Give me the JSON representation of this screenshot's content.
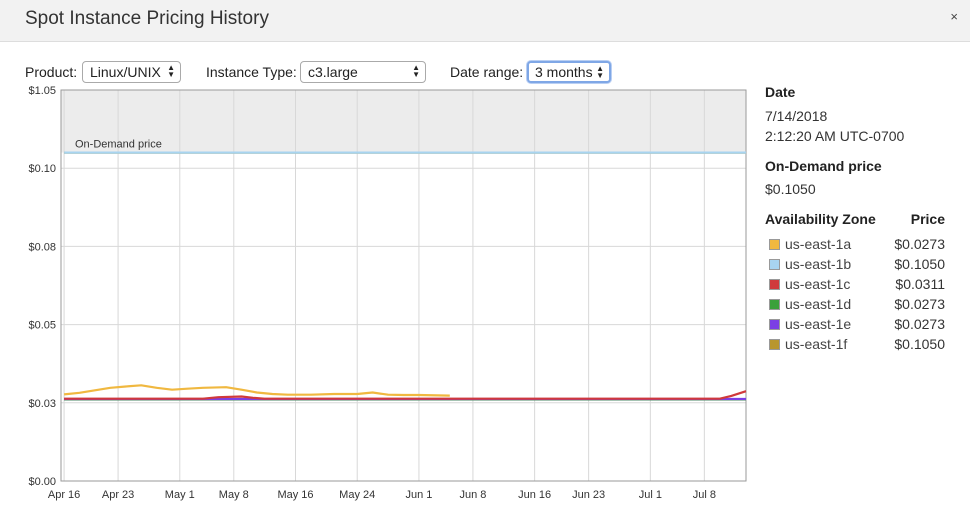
{
  "window": {
    "title": "Spot Instance Pricing History",
    "close_glyph": "×"
  },
  "controls": {
    "product_label": "Product:",
    "product_value": "Linux/UNIX",
    "instance_type_label": "Instance Type:",
    "instance_type_value": "c3.large",
    "date_range_label": "Date range:",
    "date_range_value": "3 months"
  },
  "details": {
    "date_heading": "Date",
    "date_value": "7/14/2018",
    "time_value": "2:12:20 AM UTC-0700",
    "on_demand_heading": "On-Demand price",
    "on_demand_value": "$0.1050",
    "az_heading": "Availability Zone",
    "price_heading": "Price",
    "zones": [
      {
        "name": "us-east-1a",
        "price": "$0.0273",
        "color": "#f0b840"
      },
      {
        "name": "us-east-1b",
        "price": "$0.1050",
        "color": "#a8d4f0"
      },
      {
        "name": "us-east-1c",
        "price": "$0.0311",
        "color": "#d0393b"
      },
      {
        "name": "us-east-1d",
        "price": "$0.0273",
        "color": "#3aa13a"
      },
      {
        "name": "us-east-1e",
        "price": "$0.0273",
        "color": "#7b3fe4"
      },
      {
        "name": "us-east-1f",
        "price": "$0.1050",
        "color": "#b8962e"
      }
    ]
  },
  "chart_data": {
    "type": "line",
    "xlabel": "",
    "ylabel": "",
    "x_ticks": [
      "Apr 16",
      "Apr 23",
      "May 1",
      "May 8",
      "May 16",
      "May 24",
      "Jun 1",
      "Jun 8",
      "Jun 16",
      "Jun 23",
      "Jul 1",
      "Jul 8"
    ],
    "x_tick_days": [
      0,
      7,
      15,
      22,
      30,
      38,
      46,
      53,
      61,
      68,
      76,
      83
    ],
    "x_range_days": [
      -0.4,
      88.4
    ],
    "y_ticks": [
      0.0,
      0.025,
      0.05,
      0.075,
      0.1,
      0.125
    ],
    "y_tick_labels": [
      "$0.00",
      "$0.03",
      "$0.05",
      "$0.08",
      "$0.10",
      "$1.05"
    ],
    "on_demand_label": "On-Demand price",
    "on_demand_price": 0.105,
    "grid": true,
    "series": [
      {
        "name": "us-east-1a",
        "color": "#f0b840",
        "points": [
          [
            0,
            0.0277
          ],
          [
            2,
            0.0282
          ],
          [
            4,
            0.029
          ],
          [
            6,
            0.0298
          ],
          [
            8,
            0.0302
          ],
          [
            10,
            0.0306
          ],
          [
            12,
            0.0298
          ],
          [
            14,
            0.0292
          ],
          [
            16,
            0.0295
          ],
          [
            18,
            0.0298
          ],
          [
            21,
            0.03
          ],
          [
            23,
            0.0292
          ],
          [
            25,
            0.0283
          ],
          [
            27,
            0.0278
          ],
          [
            29,
            0.0276
          ],
          [
            32,
            0.0276
          ],
          [
            35,
            0.0278
          ],
          [
            38,
            0.0278
          ],
          [
            40,
            0.0283
          ],
          [
            42,
            0.0276
          ],
          [
            44,
            0.0275
          ],
          [
            46,
            0.0275
          ],
          [
            50,
            0.0273
          ]
        ]
      },
      {
        "name": "us-east-1b",
        "color": "#a8d4f0",
        "points": [
          [
            0,
            0.105
          ],
          [
            88.4,
            0.105
          ]
        ]
      },
      {
        "name": "us-east-1c",
        "color": "#d0393b",
        "points": [
          [
            0,
            0.0263
          ],
          [
            18,
            0.0263
          ],
          [
            20,
            0.0268
          ],
          [
            23,
            0.027
          ],
          [
            24.5,
            0.0266
          ],
          [
            26,
            0.0263
          ],
          [
            85,
            0.0263
          ],
          [
            86.5,
            0.0272
          ],
          [
            88.4,
            0.0287
          ]
        ]
      },
      {
        "name": "us-east-1d",
        "color": "#3aa13a",
        "points": [
          [
            0,
            0.0261
          ],
          [
            88.4,
            0.0261
          ]
        ]
      },
      {
        "name": "us-east-1e",
        "color": "#7b3fe4",
        "points": [
          [
            0,
            0.0262
          ],
          [
            88.4,
            0.0262
          ]
        ]
      },
      {
        "name": "us-east-1f",
        "color": "#b8962e",
        "points": [
          [
            0,
            0.105
          ],
          [
            88.4,
            0.105
          ]
        ]
      }
    ]
  }
}
